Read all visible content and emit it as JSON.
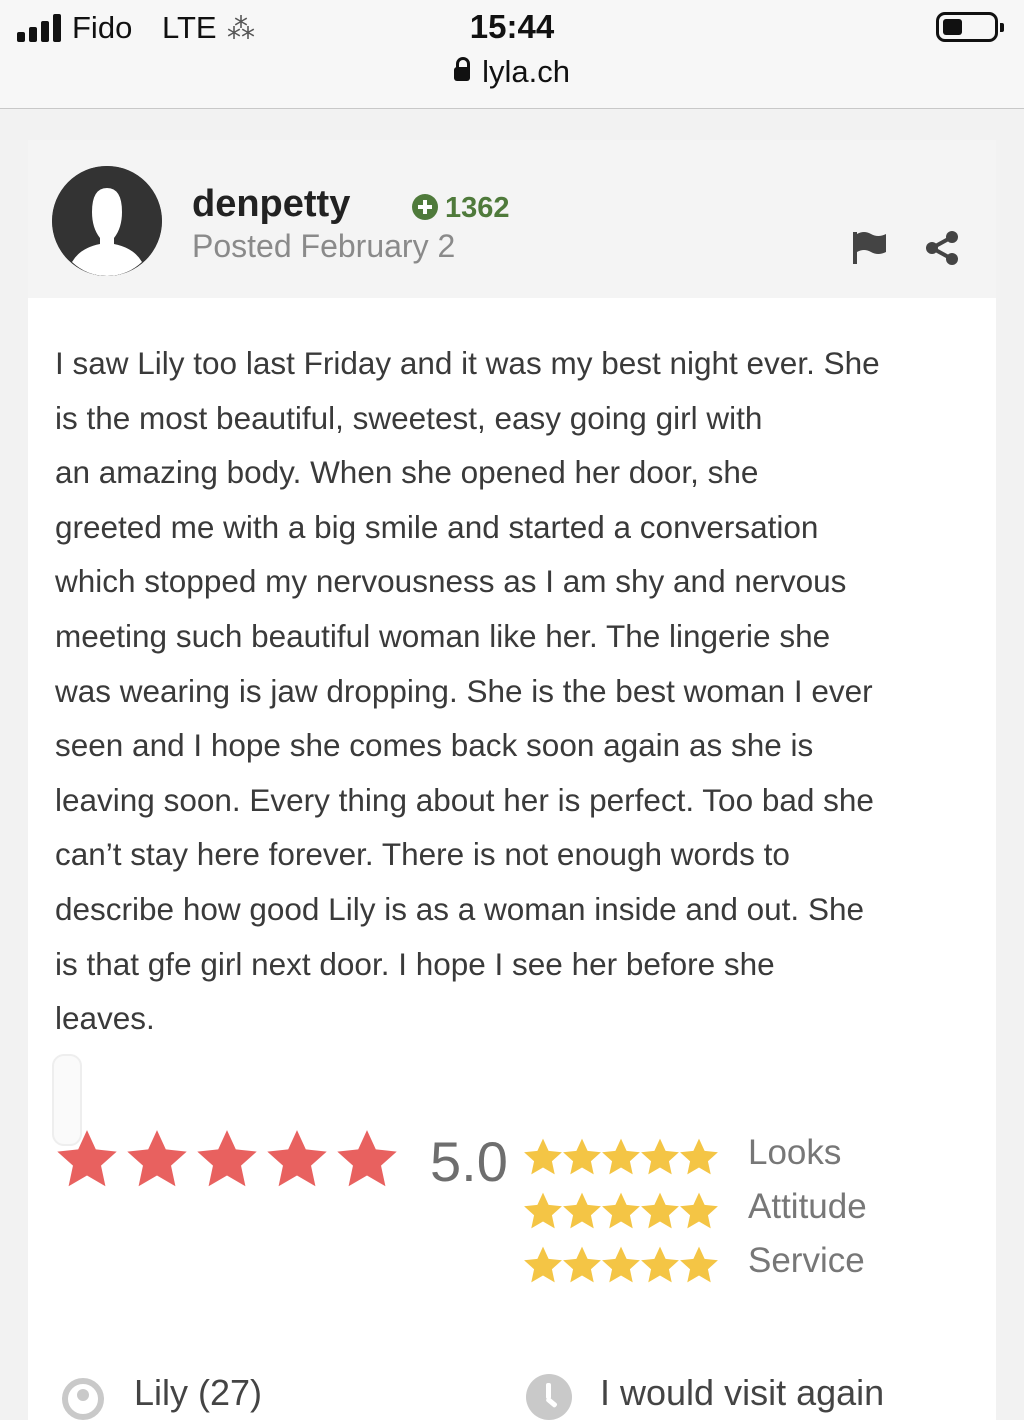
{
  "status_bar": {
    "carrier": "Fido",
    "network": "LTE",
    "time": "15:44",
    "url": "lyla.ch",
    "battery_level": 0.35
  },
  "post": {
    "username": "denpetty",
    "points": "1362",
    "posted": "Posted February 2",
    "points_color": "#4f7a3b"
  },
  "review": {
    "text": "I saw Lily too last Friday and it was my best night ever. She\nis the most beautiful, sweetest, easy going girl with\nan amazing body. When she opened her door, she\ngreeted me with a big smile and started a conversation\nwhich stopped my nervousness as I am shy and nervous\nmeeting such beautiful woman like her. The lingerie she\nwas wearing is jaw dropping. She is the best woman I ever\nseen and I hope she comes back soon again as she is\nleaving soon. Every thing about her is perfect. Too bad she\ncan’t stay here forever. There is not enough words to\ndescribe how good Lily is as a woman inside and out. She\nis that gfe girl next door. I hope I see her before she\nleaves."
  },
  "rating": {
    "overall": "5.0",
    "overall_stars": 5,
    "overall_star_color": "#e8615f",
    "category_star_color": "#f4c545",
    "categories": [
      {
        "label": "Looks",
        "stars": 5
      },
      {
        "label": "Attitude",
        "stars": 5
      },
      {
        "label": "Service",
        "stars": 5
      }
    ]
  },
  "footer": {
    "person": "Lily (27)",
    "visit": "I would visit again"
  },
  "icons": [
    "signal-icon",
    "loading-icon",
    "battery-icon",
    "lock-icon",
    "avatar-icon",
    "plus-icon",
    "flag-icon",
    "share-icon",
    "star-icon",
    "person-icon",
    "clock-icon"
  ]
}
